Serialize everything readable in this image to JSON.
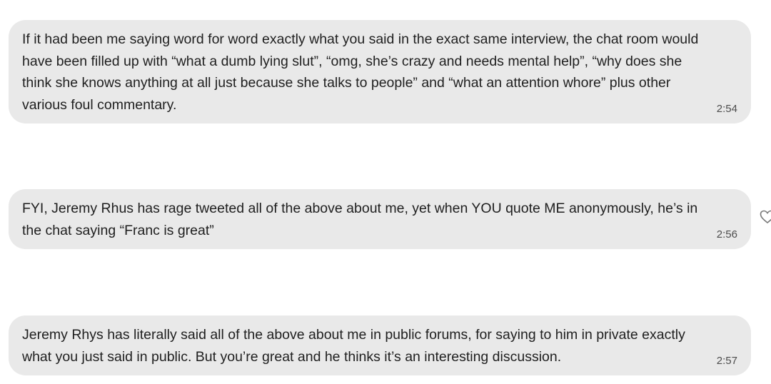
{
  "messages": [
    {
      "text": "If it had been me saying word for word  exactly what you said in the exact same interview, the chat room would have been filled up with “what a dumb lying slut”, “omg, she’s crazy and needs mental help”,  “why does she think she knows anything at all just because she talks to people” and “what an attention whore” plus other various foul commentary.",
      "time": "2:54"
    },
    {
      "text": "FYI, Jeremy Rhus has rage tweeted all of the above about me, yet when YOU quote ME anonymously, he’s in the chat saying “Franc is great”",
      "time": "2:56"
    },
    {
      "text": "Jeremy Rhys has literally said all of the above about me in public forums, for saying to him in private exactly what you just said in public. But you’re great and he thinks it’s an interesting discussion.",
      "time": "2:57"
    }
  ],
  "icons": {
    "reaction": "heart-icon"
  }
}
